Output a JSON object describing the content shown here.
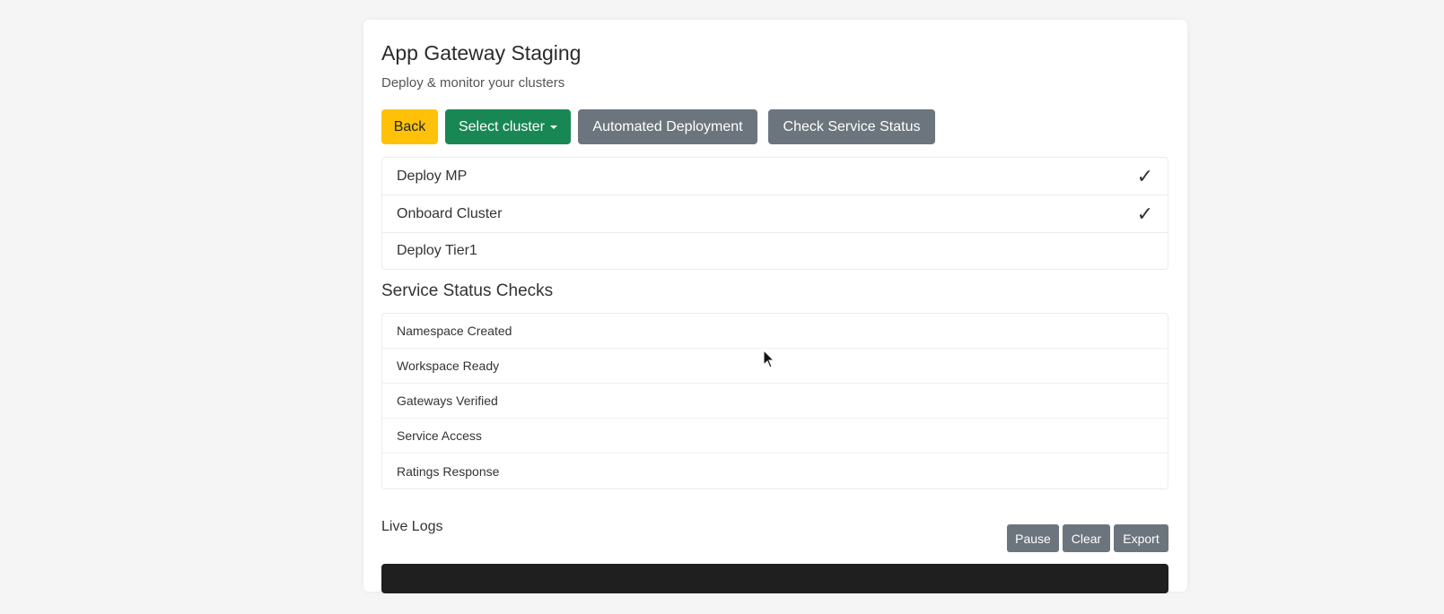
{
  "header": {
    "title": "App Gateway Staging",
    "subtitle": "Deploy & monitor your clusters"
  },
  "toolbar": {
    "back_label": "Back",
    "select_cluster_label": "Select cluster",
    "automated_deployment_label": "Automated Deployment",
    "check_service_status_label": "Check Service Status"
  },
  "steps": [
    {
      "label": "Deploy MP",
      "done_mark": "✓"
    },
    {
      "label": "Onboard Cluster",
      "done_mark": "✓"
    },
    {
      "label": "Deploy Tier1",
      "done_mark": ""
    }
  ],
  "service_checks": {
    "title": "Service Status Checks",
    "items": [
      "Namespace Created",
      "Workspace Ready",
      "Gateways Verified",
      "Service Access",
      "Ratings Response"
    ]
  },
  "logs": {
    "label": "Live Logs",
    "pause_label": "Pause",
    "clear_label": "Clear",
    "export_label": "Export"
  },
  "colors": {
    "back": "#ffc107",
    "select_cluster": "#198754",
    "secondary": "#6c757d",
    "console": "#1f1f1f"
  }
}
